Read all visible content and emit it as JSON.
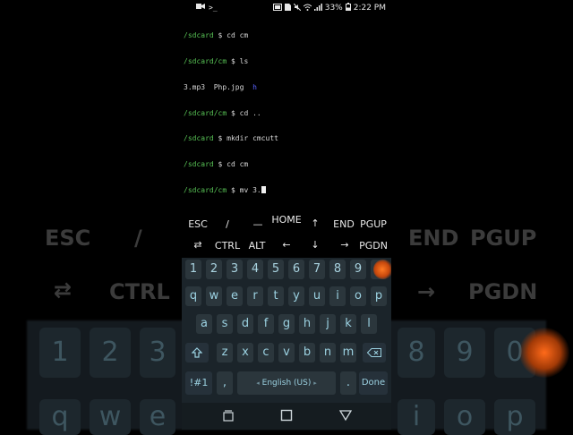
{
  "status_bar": {
    "battery_percent": "33%",
    "time": "2:22 PM"
  },
  "terminal": {
    "lines": [
      {
        "prompt": "/sdcard",
        "cmd": " $ cd cm"
      },
      {
        "prompt": "/sdcard/cm",
        "cmd": " $ ls"
      },
      {
        "output": "3.mp3  Php.jpg  ",
        "output_blue": "h"
      },
      {
        "prompt": "/sdcard/cm",
        "cmd": " $ cd .."
      },
      {
        "prompt": "/sdcard",
        "cmd": " $ mkdir cmcutt"
      },
      {
        "prompt": "/sdcard",
        "cmd": " $ cd cm"
      },
      {
        "prompt": "/sdcard/cm",
        "cmd": " $ mv 3."
      }
    ]
  },
  "extra_keys": {
    "row1": [
      "ESC",
      "/",
      "—",
      "HOME",
      "↑",
      "END",
      "PGUP"
    ],
    "row2": [
      "⇄",
      "CTRL",
      "ALT",
      "←",
      "↓",
      "→",
      "PGDN"
    ]
  },
  "keyboard": {
    "numbers": [
      "1",
      "2",
      "3",
      "4",
      "5",
      "6",
      "7",
      "8",
      "9",
      "0"
    ],
    "row_q": [
      "q",
      "w",
      "e",
      "r",
      "t",
      "y",
      "u",
      "i",
      "o",
      "p"
    ],
    "row_a": [
      "a",
      "s",
      "d",
      "f",
      "g",
      "h",
      "j",
      "k",
      "l"
    ],
    "row_z": [
      "z",
      "x",
      "c",
      "v",
      "b",
      "n",
      "m"
    ],
    "symbols": "!#1",
    "comma": ",",
    "space_label": "English (US)",
    "period": ".",
    "done": "Done"
  },
  "background_blur": {
    "row1": [
      "ESC",
      "/",
      "END",
      "PGUP"
    ],
    "row2": [
      "CTRL",
      "→",
      "PGDN"
    ],
    "numbers_left": [
      "1",
      "2",
      "3"
    ],
    "numbers_right": [
      "8",
      "9",
      "0"
    ],
    "letters_left": [
      "q",
      "w",
      "e"
    ],
    "letters_right": [
      "i",
      "o",
      "p"
    ]
  }
}
